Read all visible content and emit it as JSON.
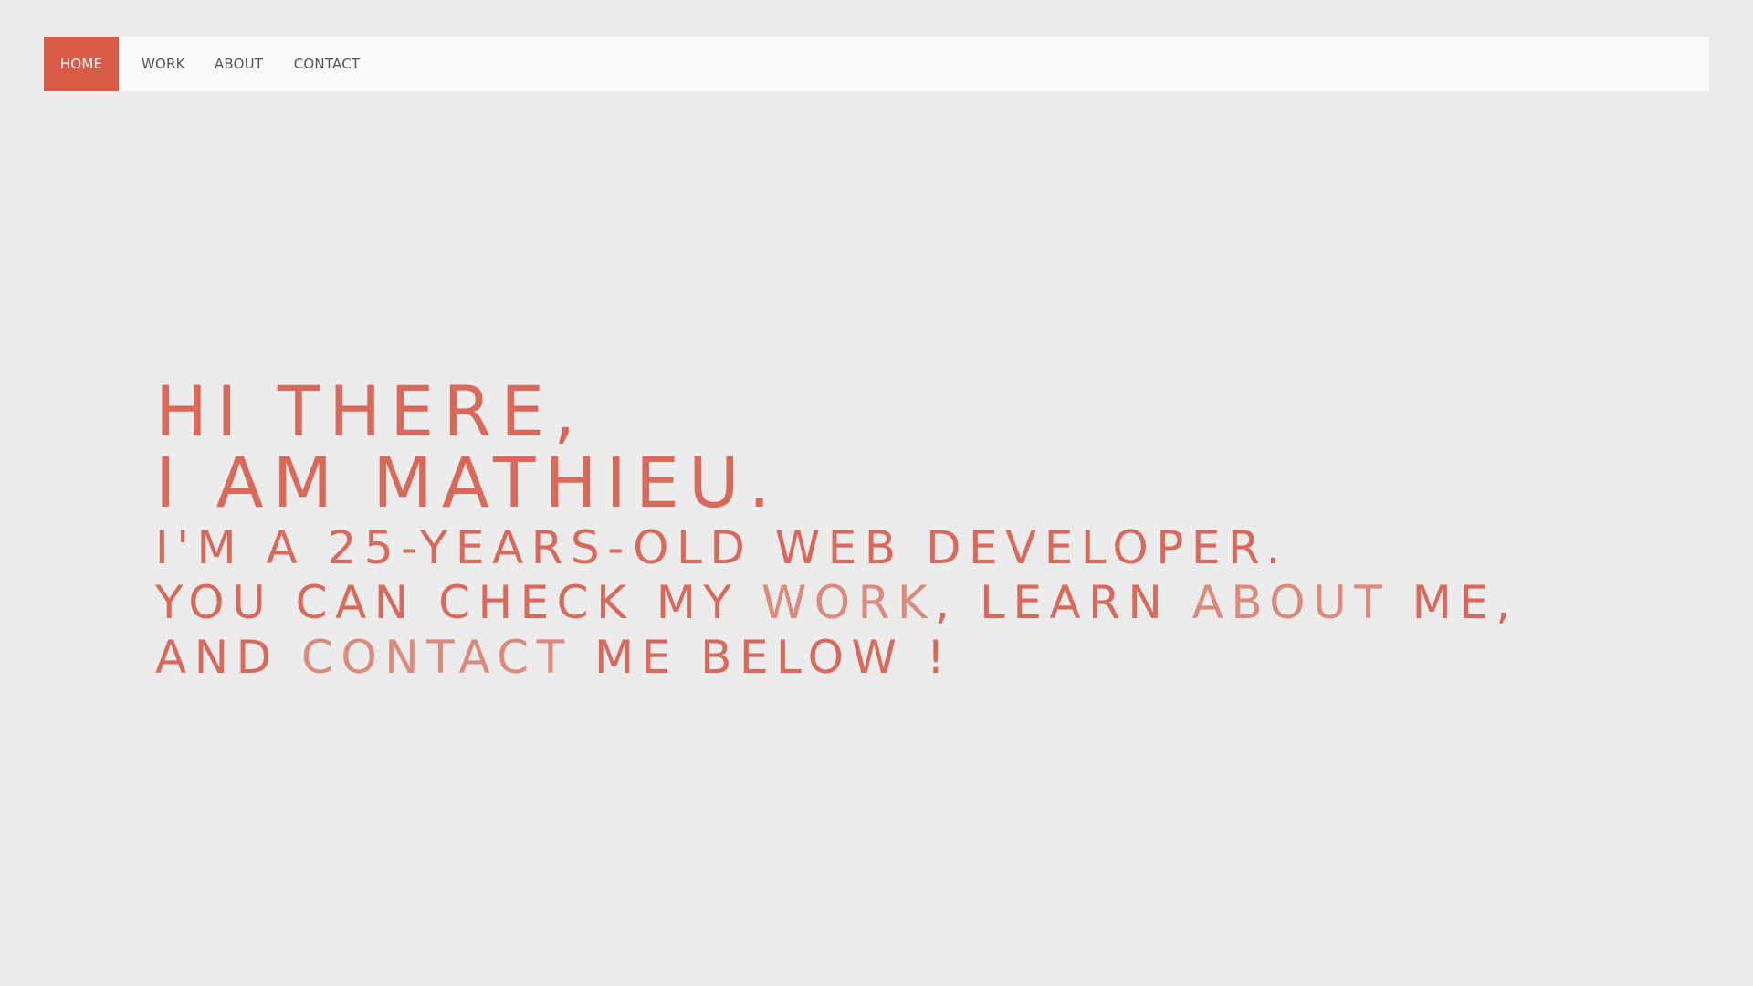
{
  "nav": {
    "items": [
      {
        "label": "HOME",
        "active": true
      },
      {
        "label": "WORK",
        "active": false
      },
      {
        "label": "ABOUT",
        "active": false
      },
      {
        "label": "CONTACT",
        "active": false
      }
    ]
  },
  "hero": {
    "line1": "HI THERE,",
    "line2": "I AM MATHIEU.",
    "line3": "I'M A 25-YEARS-OLD WEB DEVELOPER.",
    "line4_a": "YOU CAN CHECK MY ",
    "line4_work": "WORK",
    "line4_b": ", LEARN ",
    "line4_about": "ABOUT",
    "line4_c": " ME,",
    "line5_a": "AND ",
    "line5_contact": "CONTACT",
    "line5_b": " ME BELOW !"
  },
  "colors": {
    "accent": "#d85a45",
    "hero_text": "#d9695a",
    "hero_link": "#dc8a7c",
    "background": "#ececec",
    "navbar": "#fbfbfb"
  }
}
